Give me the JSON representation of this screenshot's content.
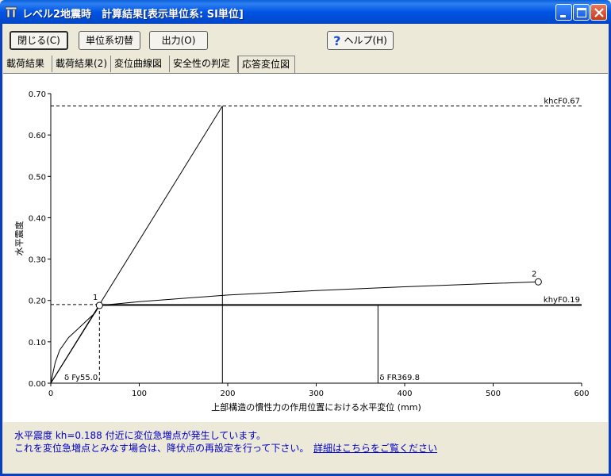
{
  "window": {
    "title": "レベル2地震時　計算結果[表示単位系: SI単位]"
  },
  "toolbar": {
    "close_label": "閉じる(C)",
    "unit_switch_label": "単位系切替",
    "output_label": "出力(O)",
    "help_label": "ヘルプ(H)"
  },
  "tabs": [
    {
      "label": "載荷結果",
      "active": false
    },
    {
      "label": "載荷結果(2)",
      "active": false
    },
    {
      "label": "変位曲線図",
      "active": false
    },
    {
      "label": "安全性の判定",
      "active": false
    },
    {
      "label": "応答変位図",
      "active": true
    }
  ],
  "chart_data": {
    "type": "line",
    "xlabel": "上部構造の慣性力の作用位置における水平変位 (mm)",
    "ylabel": "水平震度",
    "xlim": [
      0,
      600
    ],
    "ylim": [
      0,
      0.7
    ],
    "x_ticks": [
      "0",
      "100",
      "200",
      "300",
      "400",
      "500",
      "600"
    ],
    "y_ticks": [
      "0.00",
      "0.10",
      "0.20",
      "0.30",
      "0.40",
      "0.50",
      "0.60",
      "0.70"
    ],
    "series": [
      {
        "values": [
          [
            0,
            0
          ],
          [
            5,
            0.05
          ],
          [
            10,
            0.08
          ],
          [
            20,
            0.11
          ],
          [
            30,
            0.13
          ],
          [
            40,
            0.15
          ],
          [
            50,
            0.17
          ],
          [
            55,
            0.188
          ]
        ]
      },
      {
        "values": [
          [
            0,
            0
          ],
          [
            55,
            0.188
          ],
          [
            100,
            0.197
          ],
          [
            200,
            0.213
          ],
          [
            300,
            0.224
          ],
          [
            400,
            0.233
          ],
          [
            500,
            0.241
          ],
          [
            551,
            0.245
          ]
        ]
      },
      {
        "values": [
          [
            0,
            0
          ],
          [
            55,
            0.188
          ]
        ]
      },
      {
        "values": [
          [
            0,
            0
          ],
          [
            194,
            0.67
          ]
        ]
      },
      {
        "values": [
          [
            55,
            0.188
          ],
          [
            600,
            0.188
          ]
        ]
      },
      {
        "values": [
          [
            0,
            0
          ],
          [
            600,
            0
          ]
        ]
      }
    ],
    "reference_lines": {
      "khc": {
        "label": "khcF0.67",
        "value": 0.67
      },
      "khy": {
        "label": "khyF0.19",
        "value": 0.19
      },
      "dy": {
        "label": "δ Fy55.0",
        "x": 55.0,
        "y_top": 0.188
      },
      "dr": {
        "label": "δ FR369.8",
        "x": 369.8,
        "y_top": 0.188
      },
      "du": {
        "x": 194,
        "y_top": 0.67
      }
    },
    "points": [
      {
        "label": "1",
        "x": 55,
        "y": 0.188
      },
      {
        "label": "2",
        "x": 551,
        "y": 0.245
      }
    ]
  },
  "status": {
    "line1": "水平震度 kh=0.188 付近に変位急増点が発生しています。",
    "line2": "これを変位急増点とみなす場合は、降伏点の再設定を行って下さい。",
    "link": "詳細はこちらをご覧ください"
  }
}
